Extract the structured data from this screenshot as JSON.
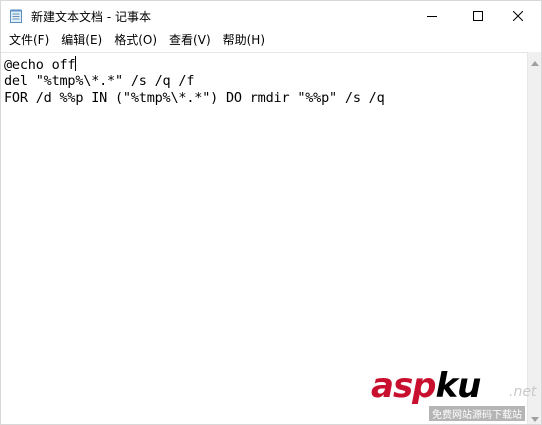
{
  "window": {
    "title": "新建文本文档 - 记事本"
  },
  "menu": {
    "items": [
      {
        "label": "文件(F)"
      },
      {
        "label": "编辑(E)"
      },
      {
        "label": "格式(O)"
      },
      {
        "label": "查看(V)"
      },
      {
        "label": "帮助(H)"
      }
    ]
  },
  "editor": {
    "lines": [
      "@echo off",
      "del \"%tmp%\\*.*\" /s /q /f",
      "FOR /d %%p IN (\"%tmp%\\*.*\") DO rmdir \"%%p\" /s /q"
    ]
  },
  "watermark": {
    "brand_main": "asp",
    "brand_ku": "ku",
    "brand_dot": ".net",
    "sub_text": "免费网站源码下载站"
  },
  "icons": {
    "app": "notepad-icon",
    "minimize": "minimize-icon",
    "maximize": "maximize-icon",
    "close": "close-icon"
  }
}
